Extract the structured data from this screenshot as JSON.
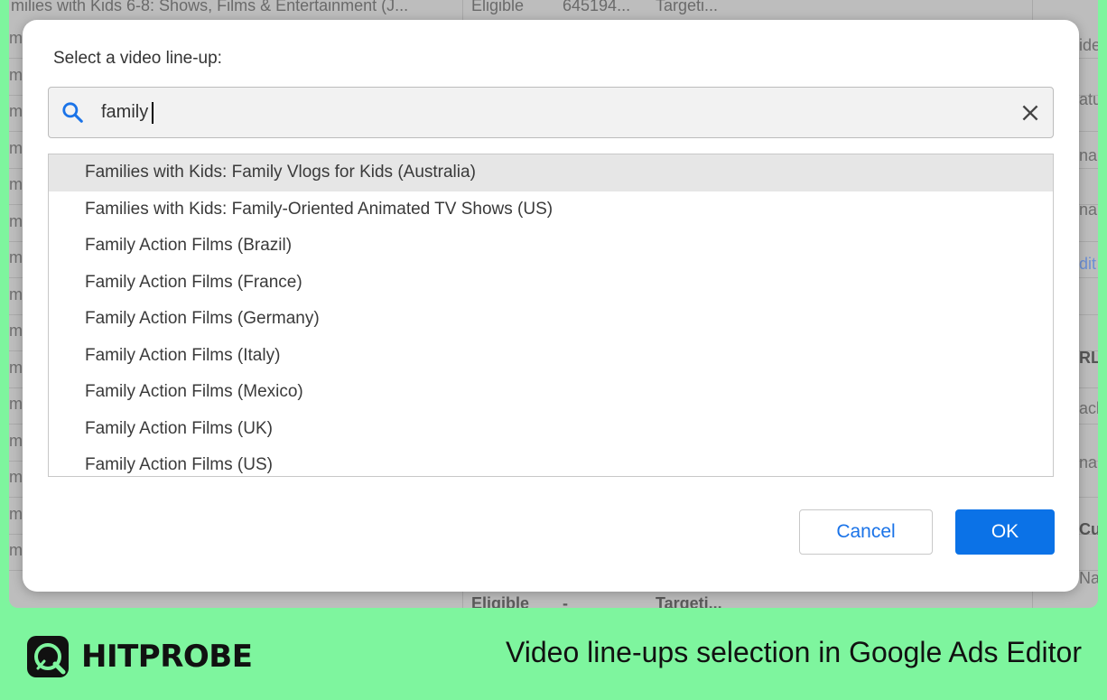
{
  "background": {
    "top_row": {
      "name": "milies with Kids 6-8: Shows, Films & Entertainment (J...",
      "status": "Eligible",
      "id": "645194...",
      "type": "Targeti..."
    },
    "bottom_row": {
      "status": "Eligible",
      "id": "-",
      "type": "Targeti..."
    },
    "row_marker": "m",
    "right_panel": [
      "ideo",
      "atu",
      "nal",
      "nal",
      "dit",
      "RL",
      "ack",
      "nal",
      "Cu",
      "Na"
    ]
  },
  "dialog": {
    "title": "Select a video line-up:",
    "search": {
      "value": "family",
      "placeholder": ""
    },
    "items": [
      "Families with Kids: Family Vlogs for Kids (Australia)",
      "Families with Kids: Family-Oriented Animated TV Shows (US)",
      "Family Action Films (Brazil)",
      "Family Action Films (France)",
      "Family Action Films (Germany)",
      "Family Action Films (Italy)",
      "Family Action Films (Mexico)",
      "Family Action Films (UK)",
      "Family Action Films (US)"
    ],
    "selected_index": 0,
    "cancel_label": "Cancel",
    "ok_label": "OK"
  },
  "footer": {
    "brand": "HITPROBE",
    "caption": "Video line-ups selection in Google Ads Editor"
  },
  "colors": {
    "accent": "#0b72e7",
    "brand_bg": "#7ef59e"
  },
  "icons": {
    "search": "search-icon",
    "clear": "close-icon",
    "logo": "magnifier-logo-icon"
  }
}
